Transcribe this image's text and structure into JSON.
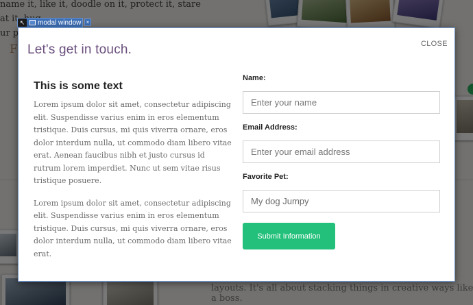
{
  "background": {
    "top_text": "name it, like it, doodle on it, protect it, stare at it, hug\nur photos need to get organized.",
    "side_letter": "F",
    "bottom_text": "layouts. It's all about stacking things in creative ways like a boss."
  },
  "inspector": {
    "icon": "cursor-icon",
    "label": "modal window",
    "close_glyph": "×"
  },
  "modal": {
    "title": "Let's get in touch.",
    "close_label": "CLOSE",
    "heading": "This is some text",
    "paragraphs": [
      "Lorem ipsum dolor sit amet, consectetur adipiscing elit. Suspendisse varius enim in eros elementum tristique. Duis cursus, mi quis viverra ornare, eros dolor interdum nulla, ut commodo diam libero vitae erat. Aenean faucibus nibh et justo cursus id rutrum lorem imperdiet. Nunc ut sem vitae risus tristique posuere.",
      "Lorem ipsum dolor sit amet, consectetur adipiscing elit. Suspendisse varius enim in eros elementum tristique. Duis cursus, mi quis viverra ornare, eros dolor interdum nulla, ut commodo diam libero vitae erat."
    ],
    "form": {
      "name_label": "Name:",
      "name_placeholder": "Enter your name",
      "email_label": "Email Address:",
      "email_placeholder": "Enter your email address",
      "pet_label": "Favorite Pet:",
      "pet_value": "My dog Jumpy",
      "submit_label": "Submit Information"
    }
  },
  "colors": {
    "title": "#6a4e7c",
    "submit": "#22c07a",
    "inspector": "#3d6fb6"
  }
}
